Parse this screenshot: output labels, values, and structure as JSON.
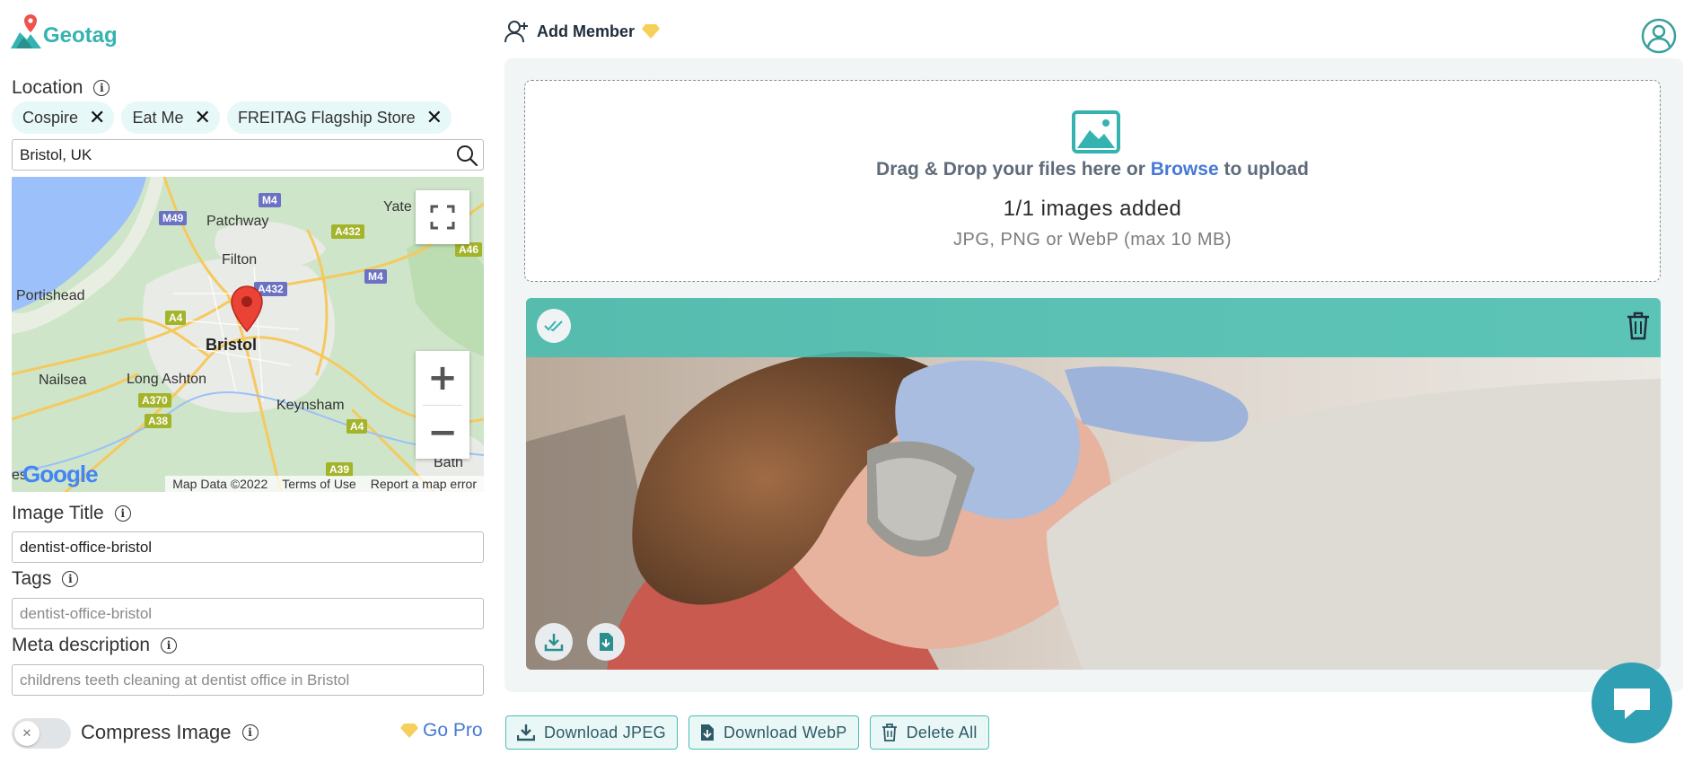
{
  "app": {
    "logo_text": "Geotag",
    "brand_color": "#35b3b1",
    "accent_color": "#4779d3"
  },
  "header": {
    "add_member_label": "Add Member",
    "premium_icon": "diamond-icon",
    "avatar_icon": "user-circle-icon"
  },
  "sidebar": {
    "location": {
      "label": "Location",
      "chips": [
        {
          "label": "Cospire"
        },
        {
          "label": "Eat Me"
        },
        {
          "label": "FREITAG Flagship Store"
        }
      ],
      "search_value": "Bristol, UK"
    },
    "map": {
      "labels": {
        "patchway": "Patchway",
        "yate": "Yate",
        "filton": "Filton",
        "portishead": "Portishead",
        "bristol": "Bristol",
        "nailsea": "Nailsea",
        "long_ashton": "Long Ashton",
        "keynsham": "Keynsham",
        "bath": "Bath",
        "es": "es"
      },
      "roads": {
        "m4a": "M4",
        "m49": "M49",
        "a432a": "A432",
        "a46": "A46",
        "a432b": "A432",
        "m4b": "M4",
        "a4a": "A4",
        "a370": "A370",
        "a38": "A38",
        "a4b": "A4",
        "a39": "A39"
      },
      "footer": {
        "map_data": "Map Data ©2022",
        "terms": "Terms of Use",
        "report": "Report a map error"
      },
      "google_logo": "Google",
      "zoom_in": "+",
      "zoom_out": "−"
    },
    "image_title": {
      "label": "Image Title",
      "value": "dentist-office-bristol"
    },
    "tags": {
      "label": "Tags",
      "placeholder": "dentist-office-bristol"
    },
    "meta_description": {
      "label": "Meta description",
      "placeholder": "childrens teeth cleaning at dentist office in Bristol"
    },
    "compress": {
      "label": "Compress Image",
      "enabled": false
    },
    "go_pro_label": "Go Pro"
  },
  "upload": {
    "text_before": "Drag & Drop your files here or ",
    "browse": "Browse",
    "text_after": " to upload",
    "count_text": "1/1 images added",
    "hint": "JPG, PNG or WebP (max 10 MB)"
  },
  "image_card": {
    "status_icon": "double-check-icon",
    "delete_icon": "trash-icon",
    "band_color": "#48beb0"
  },
  "bottom": {
    "download_jpeg": "Download JPEG",
    "download_webp": "Download WebP",
    "delete_all": "Delete All"
  }
}
